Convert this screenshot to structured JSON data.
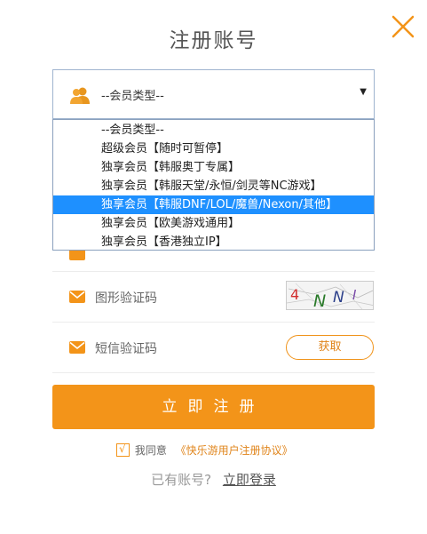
{
  "title": "注册账号",
  "close_icon": "close-x-icon",
  "accent_color": "#f39419",
  "member_select": {
    "value": "--会员类型--",
    "options": [
      "--会员类型--",
      "超级会员【随时可暂停】",
      "独享会员【韩服奥丁专属】",
      "独享会员【韩服天堂/永恒/剑灵等NC游戏】",
      "独享会员【韩服DNF/LOL/魔兽/Nexon/其他】",
      "独享会员【欧美游戏通用】",
      "独享会员【香港独立IP】"
    ],
    "highlighted_index": 4
  },
  "captcha_row": {
    "label": "图形验证码",
    "captcha_text": "4NNI"
  },
  "sms_row": {
    "label": "短信验证码",
    "button": "获取"
  },
  "submit_button": "立即注册",
  "agreement": {
    "checked": true,
    "text": "我同意",
    "link": "《快乐游用户注册协议》"
  },
  "login_prompt": {
    "text": "已有账号?",
    "link": "立即登录"
  }
}
